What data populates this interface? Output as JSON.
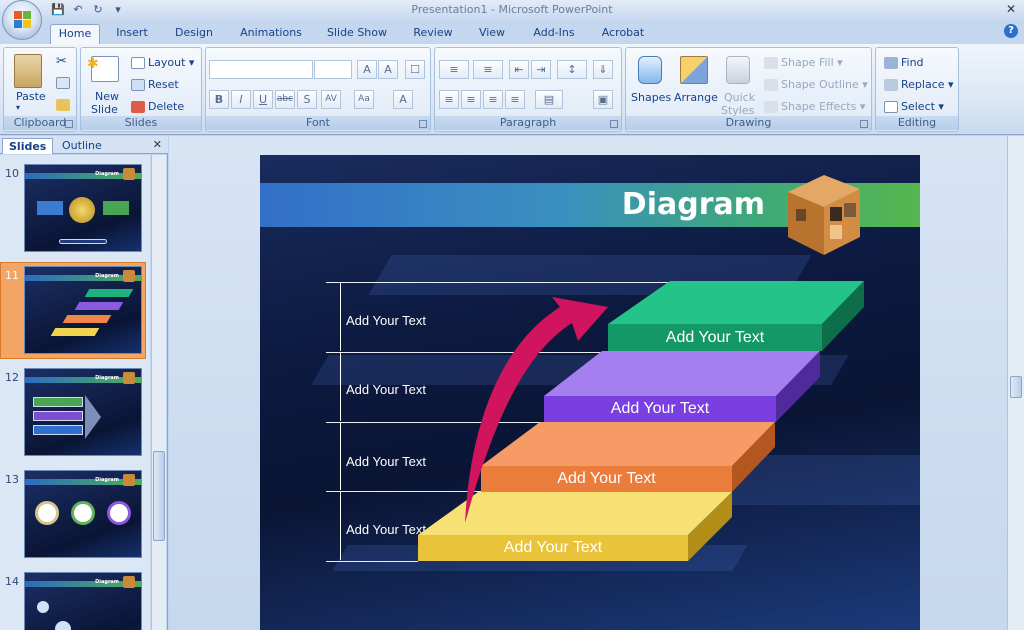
{
  "window": {
    "title": "Presentation1 - Microsoft PowerPoint"
  },
  "tabs": [
    "Home",
    "Insert",
    "Design",
    "Animations",
    "Slide Show",
    "Review",
    "View",
    "Add-Ins",
    "Acrobat"
  ],
  "ribbon": {
    "clipboard": {
      "label": "Clipboard",
      "paste": "Paste"
    },
    "slides": {
      "label": "Slides",
      "new_slide_1": "New",
      "new_slide_2": "Slide",
      "layout": "Layout",
      "reset": "Reset",
      "delete": "Delete"
    },
    "font": {
      "label": "Font"
    },
    "paragraph": {
      "label": "Paragraph"
    },
    "drawing": {
      "label": "Drawing",
      "shapes": "Shapes",
      "arrange": "Arrange",
      "quick_styles_1": "Quick",
      "quick_styles_2": "Styles",
      "shape_fill": "Shape Fill",
      "shape_outline": "Shape Outline",
      "shape_effects": "Shape Effects"
    },
    "editing": {
      "label": "Editing",
      "find": "Find",
      "replace": "Replace",
      "select": "Select"
    }
  },
  "left_pane": {
    "tabs": [
      "Slides",
      "Outline"
    ],
    "thumbnails": [
      {
        "number": "10",
        "title": "Diagram"
      },
      {
        "number": "11",
        "title": "Diagram"
      },
      {
        "number": "12",
        "title": "Diagram"
      },
      {
        "number": "13",
        "title": "Diagram"
      },
      {
        "number": "14",
        "title": "Diagram"
      }
    ],
    "selected": "11"
  },
  "slide": {
    "title": "Diagram",
    "left_labels": [
      "Add Your Text",
      "Add Your Text",
      "Add Your Text",
      "Add Your Text"
    ],
    "steps": [
      {
        "text": "Add Your Text",
        "color": "#1fb27e"
      },
      {
        "text": "Add Your Text",
        "color": "#8a5be0"
      },
      {
        "text": "Add Your Text",
        "color": "#f0864a"
      },
      {
        "text": "Add Your Text",
        "color": "#f1d34d"
      }
    ],
    "arrow_color": "#d0145e"
  }
}
